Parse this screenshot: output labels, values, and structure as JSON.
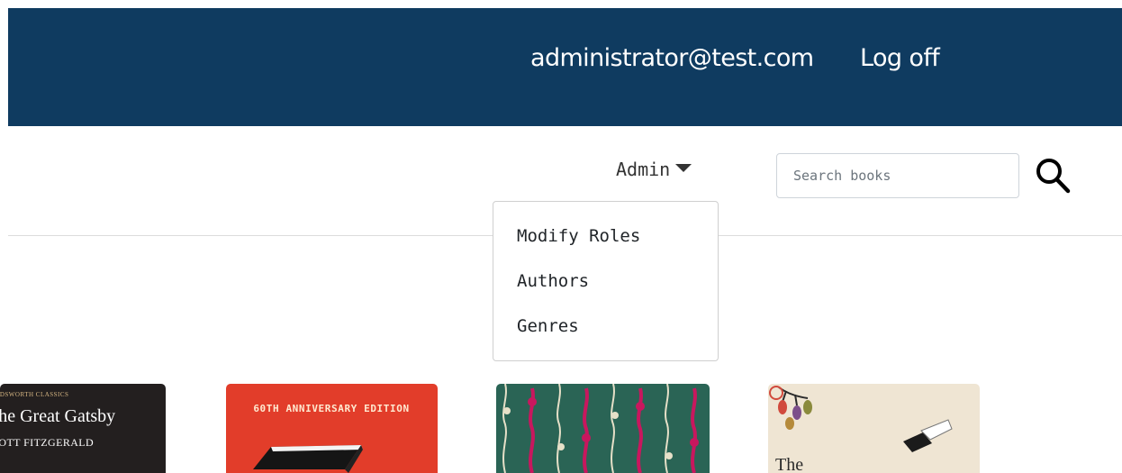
{
  "header": {
    "user_email": "administrator@test.com",
    "logoff_label": "Log off"
  },
  "nav": {
    "admin_label": "Admin",
    "search": {
      "placeholder": "Search books",
      "icon": "search-icon"
    }
  },
  "admin_menu": {
    "items": [
      {
        "label": "Modify Roles"
      },
      {
        "label": "Authors"
      },
      {
        "label": "Genres"
      }
    ]
  },
  "books": [
    {
      "publisher_line": "WORDSWORTH CLASSICS",
      "title": "The Great Gatsby",
      "author": "F. SCOTT FITZGERALD"
    },
    {
      "edition": "60TH ANNIVERSARY EDITION"
    },
    {
      "cover_pattern": "floral"
    },
    {
      "title_fragment": "The"
    }
  ],
  "colors": {
    "header_bg": "#0f3b60",
    "header_text": "#ffffff",
    "divider": "#dcdcdc",
    "book1_bg": "#231f1f",
    "book2_bg": "#e23d2a",
    "book3_bg": "#2a6455",
    "book4_bg": "#efe5d3"
  }
}
